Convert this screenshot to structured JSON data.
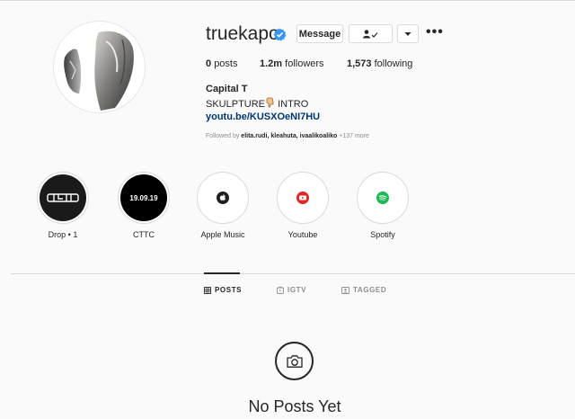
{
  "profile": {
    "username": "truekapo",
    "buttons": {
      "message": "Message"
    },
    "stats": {
      "posts_value": "0",
      "posts_label": "posts",
      "followers_value": "1.2m",
      "followers_label": "followers",
      "following_value": "1,573",
      "following_label": "following"
    },
    "full_name": "Capital T",
    "bio_before": "SKULPTURE",
    "bio_after": " INTRO",
    "link": "youtu.be/KUSXOeNI7HU",
    "followed_by_prefix": "Followed by ",
    "followed_by_names": "elita.rudi, kleahuta, ivaalikoaliko",
    "followed_by_more": " +137 more"
  },
  "highlights": [
    {
      "label": "Drop • 1"
    },
    {
      "label": "CTTC",
      "cover_text": "19.09.19"
    },
    {
      "label": "Apple Music"
    },
    {
      "label": "Youtube"
    },
    {
      "label": "Spotify"
    }
  ],
  "tabs": {
    "posts": "POSTS",
    "igtv": "IGTV",
    "tagged": "TAGGED"
  },
  "empty_state": {
    "title": "No Posts Yet"
  },
  "colors": {
    "verified": "#3897f0",
    "link": "#00376b",
    "youtube": "#e02828",
    "spotify": "#1db954"
  }
}
